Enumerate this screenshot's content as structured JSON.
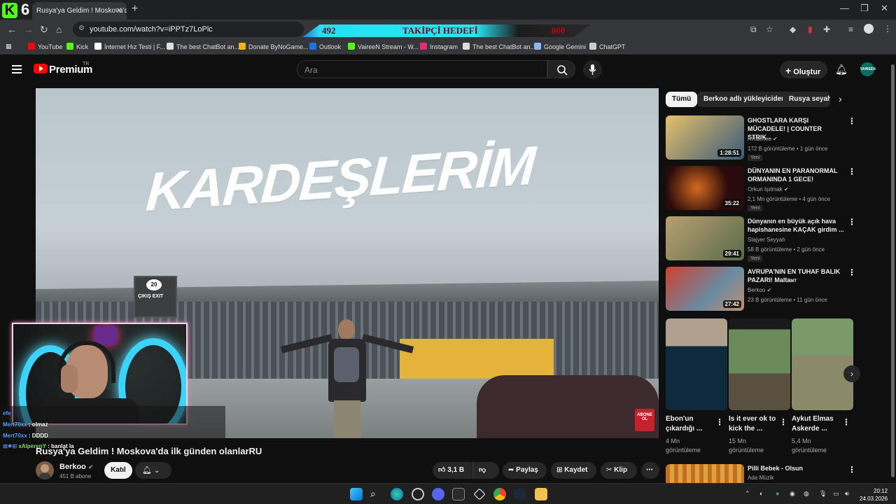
{
  "browser": {
    "tab_title": "Rusya'ya Geldim ! Moskova'da İ",
    "url": "youtube.com/watch?v=iPPTz7LoPlc",
    "overlay": {
      "k6_label": "6",
      "left_count": "492",
      "center_label": "TAKİPÇİ HEDEFİ",
      "right_count": "800"
    },
    "bookmarks": [
      {
        "label": "YouTube",
        "color": "#ff0000"
      },
      {
        "label": "Kick",
        "color": "#53fc18"
      },
      {
        "label": "İnternet Hız Testi | F...",
        "color": "#ffffff"
      },
      {
        "label": "The best ChatBot an...",
        "color": "#dddddd"
      },
      {
        "label": "Donate ByNoGame...",
        "color": "#f5b400"
      },
      {
        "label": "Outlook",
        "color": "#1a73e8"
      },
      {
        "label": "VaireeN Stream - W...",
        "color": "#53fc18"
      },
      {
        "label": "Instagram",
        "color": "#e1306c"
      },
      {
        "label": "The best ChatBot an...",
        "color": "#dddddd"
      },
      {
        "label": "Google Gemini",
        "color": "#8ab4f8"
      },
      {
        "label": "ChatGPT",
        "color": "#cccccc"
      }
    ]
  },
  "header": {
    "logo_text": "Premium",
    "logo_sup": "TR",
    "search_placeholder": "Ara",
    "create_label": "Oluştur",
    "avatar_label": "VAIREEN"
  },
  "video": {
    "overlay_title": "KARDEŞLERİM",
    "sign_number": "20",
    "sign_text": "ÇIKIŞ EXIT",
    "abone_label": "ABONE OL",
    "title": "Rusya'ya Geldim ! Moskova'da ilk günden olanlarRU",
    "channel": "Berkoo",
    "subscribers": "451 B abone",
    "join_label": "Katıl",
    "likes": "3,1 B",
    "share_label": "Paylaş",
    "save_label": "Kaydet",
    "clip_label": "Klip"
  },
  "chat": [
    {
      "user": "efe",
      "text": ""
    },
    {
      "user": "Mert70xx",
      "text": ": olmaz"
    },
    {
      "user": "Mert70xx",
      "text": ": DDDD"
    },
    {
      "user": "xAlperenY",
      "text": ": banlat la"
    }
  ],
  "sidebar": {
    "chips": [
      "Tümü",
      "Berkoo adlı yükleyiciden",
      "Rusya seyaha"
    ],
    "videos": [
      {
        "title": "GHOSTLARA KARŞI MÜCADELE! | COUNTER STRIK...",
        "channel": "RRaenee",
        "meta": "172 B görüntüleme • 1 gün önce",
        "badge": "Yeni",
        "duration": "1:28:51",
        "thumb": "#c98a3a"
      },
      {
        "title": "DÜNYANIN EN PARANORMAL ORMANINDA 1 GECE!",
        "channel": "Orkun Işıtmak",
        "meta": "2,1 Mn görüntüleme • 4 gün önce",
        "badge": "Yeni",
        "duration": "35:22",
        "thumb": "#3a1818"
      },
      {
        "title": "Dünyanın en büyük açık hava hapishanesine KAÇAK girdim ...",
        "channel": "Stajyer Seyyah",
        "meta": "58 B görüntüleme • 2 gün önce",
        "badge": "Yeni",
        "duration": "29:41",
        "thumb": "#8a7a5a"
      },
      {
        "title": "AVRUPA'NIN EN TUHAF BALIK PAZARI! Malta",
        "channel": "Berkoo",
        "meta": "23 B görüntüleme • 11 gün önce",
        "badge": "",
        "duration": "27:42",
        "thumb": "#b06a40"
      }
    ],
    "shorts": [
      {
        "title": "Ebon'un çıkardığı ...",
        "views": "4 Mn görüntüleme",
        "thumb": "#1f3a4a"
      },
      {
        "title": "Is it ever ok to kick the ...",
        "views": "15 Mn görüntüleme",
        "thumb": "#6a7a4a"
      },
      {
        "title": "Aykut Elmas Askerde ...",
        "views": "5,4 Mn görüntüleme",
        "thumb": "#5a6a4a"
      }
    ],
    "next_video": {
      "title": "Pilli Bebek - Olsun",
      "channel": "Ada Müzik"
    }
  },
  "taskbar": {
    "time": "20:12",
    "date": "24.03.2026"
  }
}
